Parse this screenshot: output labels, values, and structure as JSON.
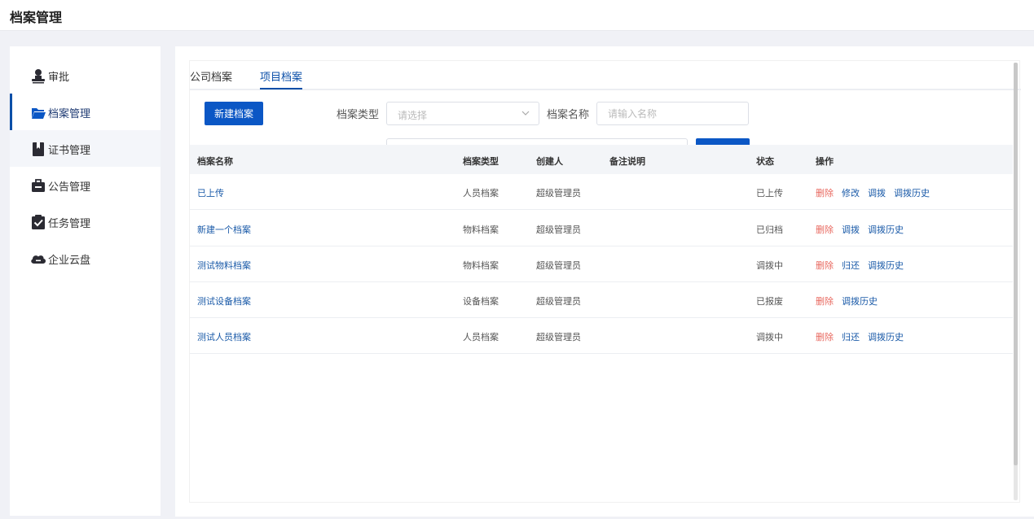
{
  "header": {
    "title": "档案管理"
  },
  "sidebar": {
    "items": [
      {
        "label": "审批",
        "icon": "user-stamp-icon"
      },
      {
        "label": "档案管理",
        "icon": "folder-open-icon"
      },
      {
        "label": "证书管理",
        "icon": "bookmark-icon"
      },
      {
        "label": "公告管理",
        "icon": "briefcase-icon"
      },
      {
        "label": "任务管理",
        "icon": "clipboard-check-icon"
      },
      {
        "label": "企业云盘",
        "icon": "cloud-icon"
      }
    ],
    "active_index": 1
  },
  "tabs": [
    {
      "label": "公司档案"
    },
    {
      "label": "项目档案"
    }
  ],
  "active_tab": 1,
  "toolbar": {
    "new_button": "新建档案",
    "type_label": "档案类型",
    "type_placeholder": "请选择",
    "name_label": "档案名称",
    "name_placeholder": "请输入名称"
  },
  "colors": {
    "accent": "#0b57c5",
    "link": "#1a5aa8",
    "danger": "#e8685f"
  },
  "table": {
    "columns": [
      "档案名称",
      "档案类型",
      "创建人",
      "备注说明",
      "状态",
      "操作"
    ],
    "rows": [
      {
        "name": "已上传",
        "type": "人员档案",
        "creator": "超级管理员",
        "remark": "",
        "status": "已上传",
        "ops": [
          "删除",
          "修改",
          "调拨",
          "调拨历史"
        ]
      },
      {
        "name": "新建一个档案",
        "type": "物料档案",
        "creator": "超级管理员",
        "remark": "",
        "status": "已归档",
        "ops": [
          "删除",
          "调拨",
          "调拨历史"
        ]
      },
      {
        "name": "测试物料档案",
        "type": "物料档案",
        "creator": "超级管理员",
        "remark": "",
        "status": "调拨中",
        "ops": [
          "删除",
          "归还",
          "调拨历史"
        ]
      },
      {
        "name": "测试设备档案",
        "type": "设备档案",
        "creator": "超级管理员",
        "remark": "",
        "status": "已报废",
        "ops": [
          "删除",
          "调拨历史"
        ]
      },
      {
        "name": "测试人员档案",
        "type": "人员档案",
        "creator": "超级管理员",
        "remark": "",
        "status": "调拨中",
        "ops": [
          "删除",
          "归还",
          "调拨历史"
        ]
      }
    ]
  }
}
